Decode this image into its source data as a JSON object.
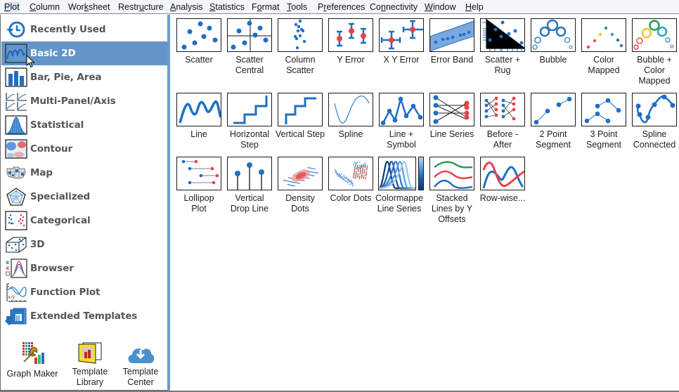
{
  "menu": [
    {
      "label": "Plot",
      "accel": "P"
    },
    {
      "label": "Column",
      "accel": "C"
    },
    {
      "label": "Worksheet",
      "accel": "k"
    },
    {
      "label": "Restructure",
      "accel": "u"
    },
    {
      "label": "Analysis",
      "accel": "A"
    },
    {
      "label": "Statistics",
      "accel": "S"
    },
    {
      "label": "Format",
      "accel": "o"
    },
    {
      "label": "Tools",
      "accel": "T"
    },
    {
      "label": "Preferences",
      "accel": "r"
    },
    {
      "label": "Connectivity",
      "accel": "n"
    },
    {
      "label": "Window",
      "accel": "W"
    },
    {
      "label": "Help",
      "accel": "H"
    }
  ],
  "sidebar": {
    "selected": "Basic 2D",
    "categories": [
      {
        "label": "Recently Used",
        "icon": "recent-history-icon"
      },
      {
        "label": "Basic 2D",
        "icon": "basic-2d-line-icon"
      },
      {
        "label": "Bar, Pie, Area",
        "icon": "bar-chart-icon"
      },
      {
        "label": "Multi-Panel/Axis",
        "icon": "multi-panel-icon"
      },
      {
        "label": "Statistical",
        "icon": "histogram-icon"
      },
      {
        "label": "Contour",
        "icon": "contour-icon"
      },
      {
        "label": "Map",
        "icon": "map-icon"
      },
      {
        "label": "Specialized",
        "icon": "radar-icon"
      },
      {
        "label": "Categorical",
        "icon": "categorical-dots-icon"
      },
      {
        "label": "3D",
        "icon": "3d-box-icon"
      },
      {
        "label": "Browser",
        "icon": "browser-icon"
      },
      {
        "label": "Function Plot",
        "icon": "function-plot-icon"
      },
      {
        "label": "Extended Templates",
        "icon": "extended-templates-icon"
      }
    ],
    "tools": [
      {
        "label": "Graph Maker",
        "icon": "graph-maker-icon"
      },
      {
        "label": "Template Library",
        "icon": "template-library-icon"
      },
      {
        "label": "Template Center",
        "icon": "cloud-download-icon"
      }
    ]
  },
  "gallery": {
    "templates": [
      {
        "label": "Scatter",
        "kind": "scatter"
      },
      {
        "label": "Scatter Central",
        "kind": "scatter-central"
      },
      {
        "label": "Column Scatter",
        "kind": "column-scatter"
      },
      {
        "label": "Y Error",
        "kind": "y-error"
      },
      {
        "label": "X Y Error",
        "kind": "xy-error"
      },
      {
        "label": "Error Band",
        "kind": "error-band"
      },
      {
        "label": "Scatter + Rug",
        "kind": "scatter-rug"
      },
      {
        "label": "Bubble",
        "kind": "bubble"
      },
      {
        "label": "Color Mapped",
        "kind": "color-mapped"
      },
      {
        "label": "Bubble + Color Mapped",
        "kind": "bubble-color"
      },
      {
        "label": "Line",
        "kind": "line"
      },
      {
        "label": "Horizontal Step",
        "kind": "h-step"
      },
      {
        "label": "Vertical Step",
        "kind": "v-step"
      },
      {
        "label": "Spline",
        "kind": "spline"
      },
      {
        "label": "Line + Symbol",
        "kind": "line-symbol"
      },
      {
        "label": "Line Series",
        "kind": "line-series"
      },
      {
        "label": "Before - After",
        "kind": "before-after"
      },
      {
        "label": "2 Point Segment",
        "kind": "two-point"
      },
      {
        "label": "3 Point Segment",
        "kind": "three-point"
      },
      {
        "label": "Spline Connected",
        "kind": "spline-connected"
      },
      {
        "label": "Lollipop Plot",
        "kind": "lollipop"
      },
      {
        "label": "Vertical Drop Line",
        "kind": "drop-line"
      },
      {
        "label": "Density Dots",
        "kind": "density-dots"
      },
      {
        "label": "Color Dots",
        "kind": "color-dots"
      },
      {
        "label": "Colormapped Line Series",
        "display": "Colormappe\nLine Series",
        "kind": "colormapped-lines"
      },
      {
        "label": "Stacked Lines by Y Offsets",
        "kind": "stacked-lines"
      },
      {
        "label": "Row-wise...",
        "kind": "row-wise"
      }
    ]
  },
  "colors": {
    "accent": "#6495c8",
    "divider": "#6b9acb",
    "plot_blue": "#1f6fc5",
    "plot_red": "#e8414b",
    "plot_green": "#2e9b57"
  }
}
